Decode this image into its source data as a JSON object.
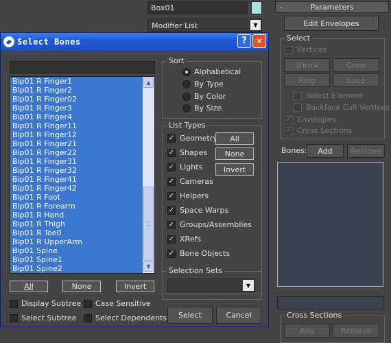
{
  "background_panel": {
    "object_name": "Box01",
    "modifier_list": "Modifier List",
    "color_swatch": "#a6e3df",
    "rollout_minus": "-",
    "rollout_title": "Parameters",
    "edit_envelopes": "Edit Envelopes",
    "select_group": "Select",
    "vertices": "Vertices",
    "shrink": "Shrink",
    "grow": "Grow",
    "ring": "Ring",
    "loop": "Loop",
    "select_element": "Select Element",
    "backface_cull": "Backface Cull Vertices",
    "envelopes": "Envelopes",
    "cross_sections": "Cross Sections",
    "bones_label": "Bones:",
    "add": "Add",
    "remove": "Remove",
    "cross_sections_group": "Cross Sections",
    "cs_add": "Add",
    "cs_remove": "Remove"
  },
  "dialog": {
    "title": "Select Bones",
    "help_button": "?",
    "close_button": "✕",
    "search_value": "",
    "bones": [
      "Bip01 R Finger1",
      "Bip01 R Finger2",
      "Bip01 R Finger02",
      "Bip01 R Finger3",
      "Bip01 R Finger4",
      "Bip01 R Finger11",
      "Bip01 R Finger12",
      "Bip01 R Finger21",
      "Bip01 R Finger22",
      "Bip01 R Finger31",
      "Bip01 R Finger32",
      "Bip01 R Finger41",
      "Bip01 R Finger42",
      "Bip01 R Foot",
      "Bip01 R Forearm",
      "Bip01 R Hand",
      "Bip01 R Thigh",
      "Bip01 R Toe0",
      "Bip01 R UpperArm",
      "Bip01 Spine",
      "Bip01 Spine1",
      "Bip01 Spine2"
    ],
    "all": "All",
    "none": "None",
    "invert": "Invert",
    "display_subtree": "Display Subtree",
    "case_sensitive": "Case Sensitive",
    "select_subtree": "Select Subtree",
    "select_dependents": "Select Dependents",
    "sort": {
      "title": "Sort",
      "options": [
        "Alphabetical",
        "By Type",
        "By Color",
        "By Size"
      ],
      "selected": "Alphabetical"
    },
    "list_types": {
      "title": "List Types",
      "items": [
        "Geometry",
        "Shapes",
        "Lights",
        "Cameras",
        "Helpers",
        "Space Warps",
        "Groups/Assemblies",
        "XRefs",
        "Bone Objects"
      ],
      "all": "All",
      "none": "None",
      "invert": "Invert"
    },
    "selection_sets": {
      "title": "Selection Sets",
      "value": ""
    },
    "select_button": "Select",
    "cancel_button": "Cancel"
  },
  "colors": {
    "titlebar": "#1f5ad6",
    "list_highlight": "#3c76cf",
    "close_button": "#e0502b"
  }
}
